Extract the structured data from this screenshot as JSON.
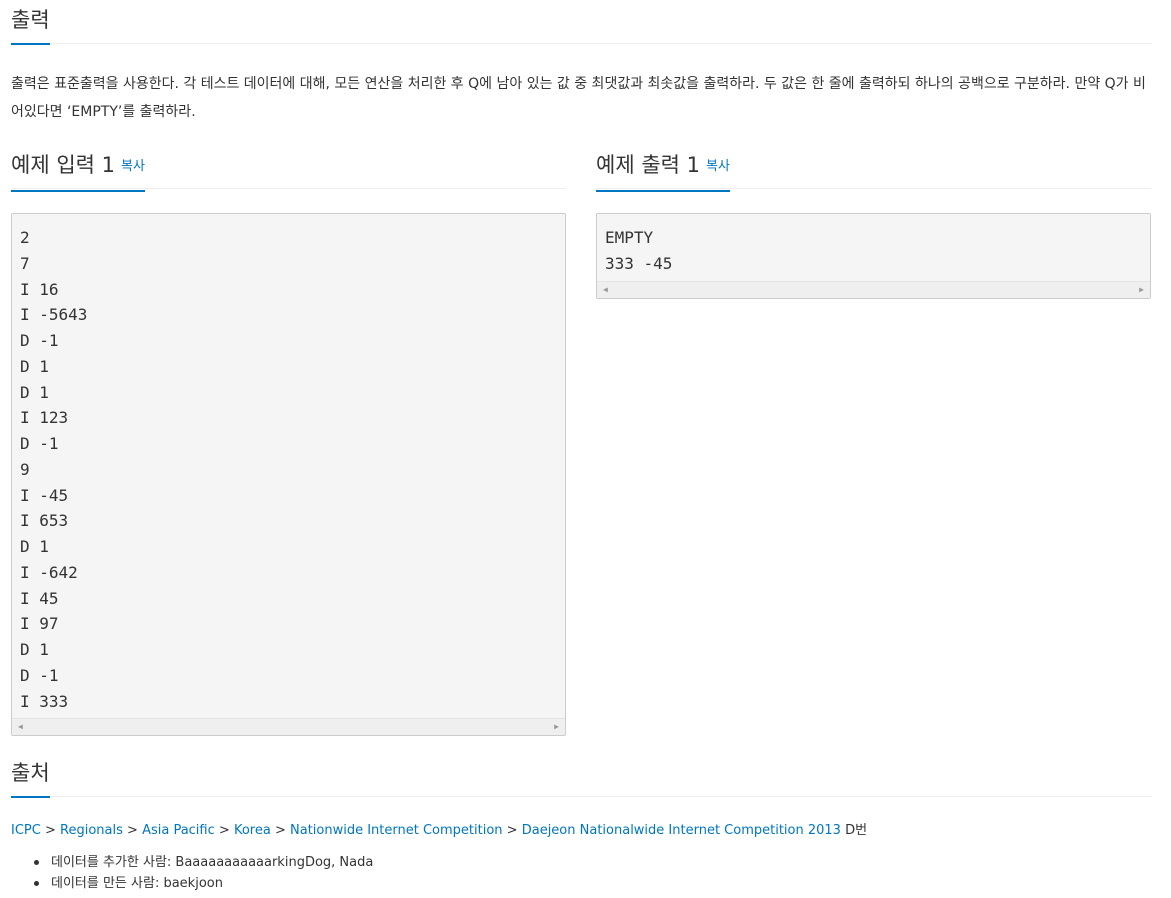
{
  "output_section": {
    "title": "출력",
    "description": "출력은 표준출력을 사용한다. 각 테스트 데이터에 대해, 모든 연산을 처리한 후 Q에 남아 있는 값 중 최댓값과 최솟값을 출력하라. 두 값은 한 줄에 출력하되 하나의 공백으로 구분하라. 만약 Q가 비어있다면 ‘EMPTY’를 출력하라."
  },
  "sample_input": {
    "title": "예제 입력 1",
    "copy_label": "복사",
    "lines": [
      "2",
      "7",
      "I 16",
      "I -5643",
      "D -1",
      "D 1",
      "D 1",
      "I 123",
      "D -1",
      "9",
      "I -45",
      "I 653",
      "D 1",
      "I -642",
      "I 45",
      "I 97",
      "D 1",
      "D -1",
      "I 333"
    ]
  },
  "sample_output": {
    "title": "예제 출력 1",
    "copy_label": "복사",
    "lines": [
      "EMPTY",
      "333 -45"
    ]
  },
  "source_section": {
    "title": "출처",
    "breadcrumb": [
      {
        "label": "ICPC"
      },
      {
        "label": "Regionals"
      },
      {
        "label": "Asia Pacific"
      },
      {
        "label": "Korea"
      },
      {
        "label": "Nationwide Internet Competition"
      },
      {
        "label": "Daejeon Nationalwide Internet Competition 2013"
      }
    ],
    "separator": ">",
    "suffix": "D번",
    "credits": [
      "데이터를 추가한 사람: BaaaaaaaaaaarkingDog, Nada",
      "데이터를 만든 사람: baekjoon"
    ]
  }
}
